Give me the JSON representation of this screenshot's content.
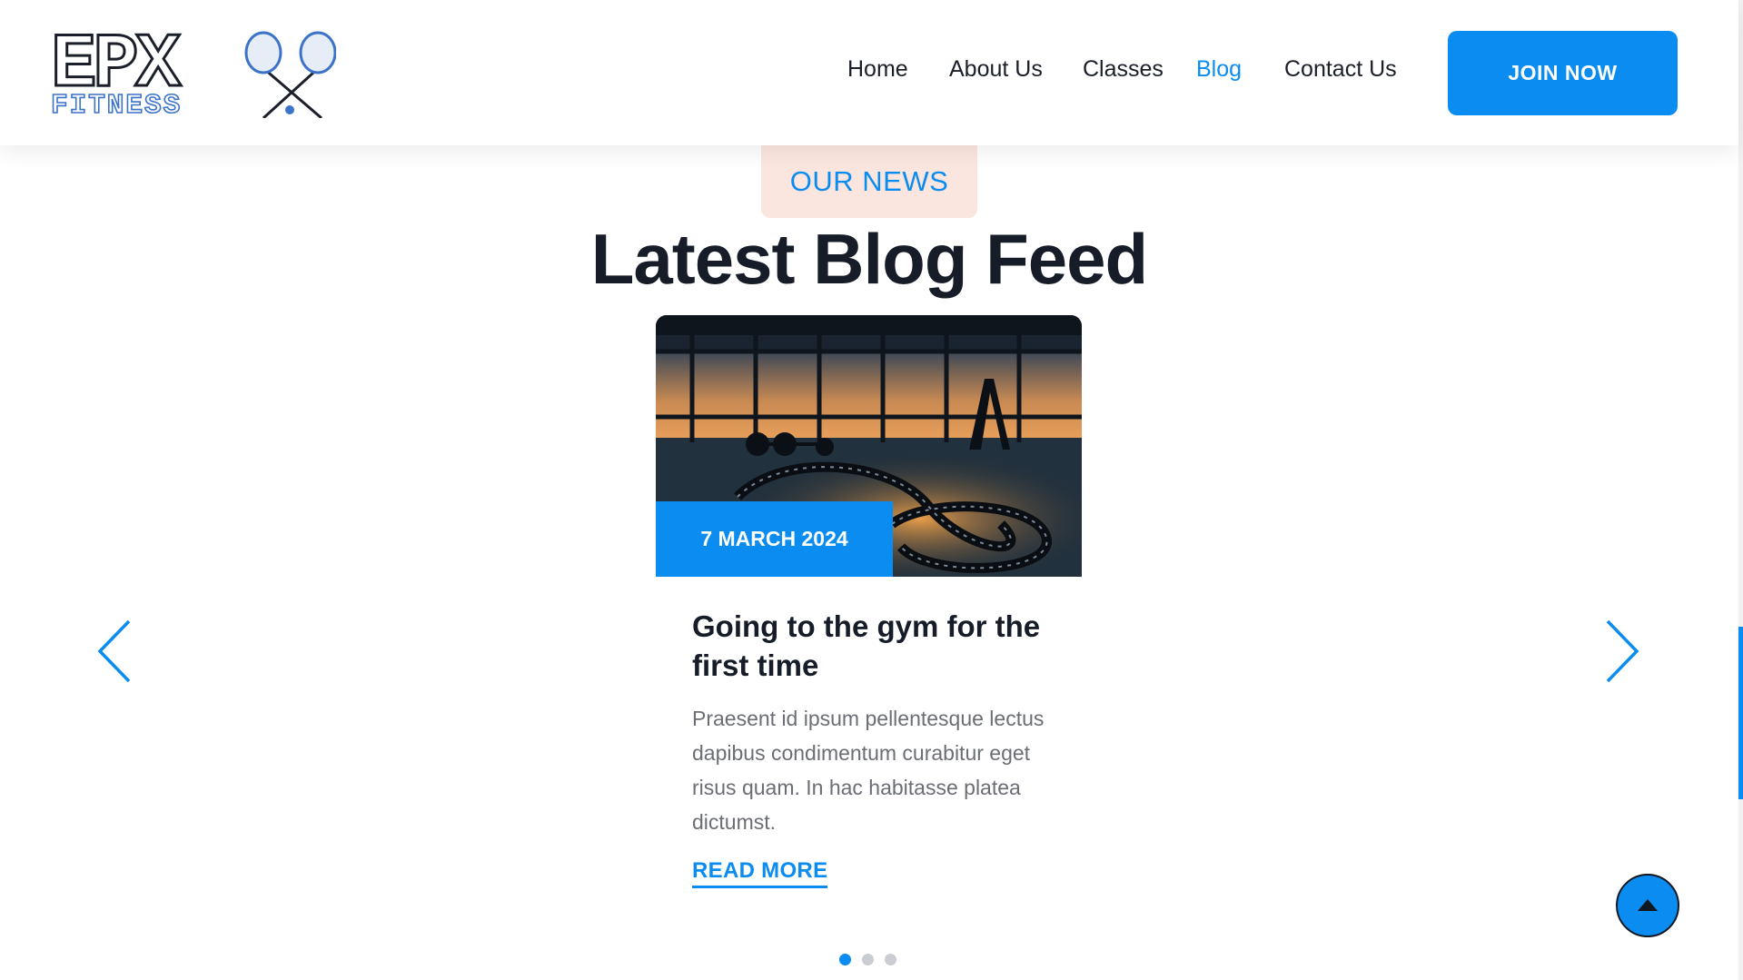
{
  "brand": {
    "logo_text": "EPX",
    "logo_subtext": "FITNESS"
  },
  "nav": {
    "items": [
      {
        "label": "Home",
        "active": false
      },
      {
        "label": "About Us",
        "active": false
      },
      {
        "label": "Classes",
        "active": false
      },
      {
        "label": "Blog",
        "active": true
      },
      {
        "label": "Contact Us",
        "active": false
      }
    ],
    "cta_label": "JOIN NOW"
  },
  "section": {
    "tag": "OUR NEWS",
    "title": "Latest Blog Feed"
  },
  "post": {
    "date": "7 MARCH 2024",
    "title": "Going to the gym for the first time",
    "excerpt": "Praesent id ipsum pellentesque lectus dapibus condimentum curabitur eget risus quam. In hac habitasse platea dictumst.",
    "read_more": "READ MORE"
  },
  "carousel": {
    "slide_count": 3,
    "active_index": 0
  },
  "icons": {
    "prev": "chevron-left-icon",
    "next": "chevron-right-icon",
    "back_to_top": "arrow-up-icon",
    "logo_graphic": "crossed-rackets-icon"
  },
  "colors": {
    "accent": "#0a8cf0",
    "tag_background": "#fbe6df",
    "heading": "#161c28",
    "body_text": "#6b6e75"
  }
}
